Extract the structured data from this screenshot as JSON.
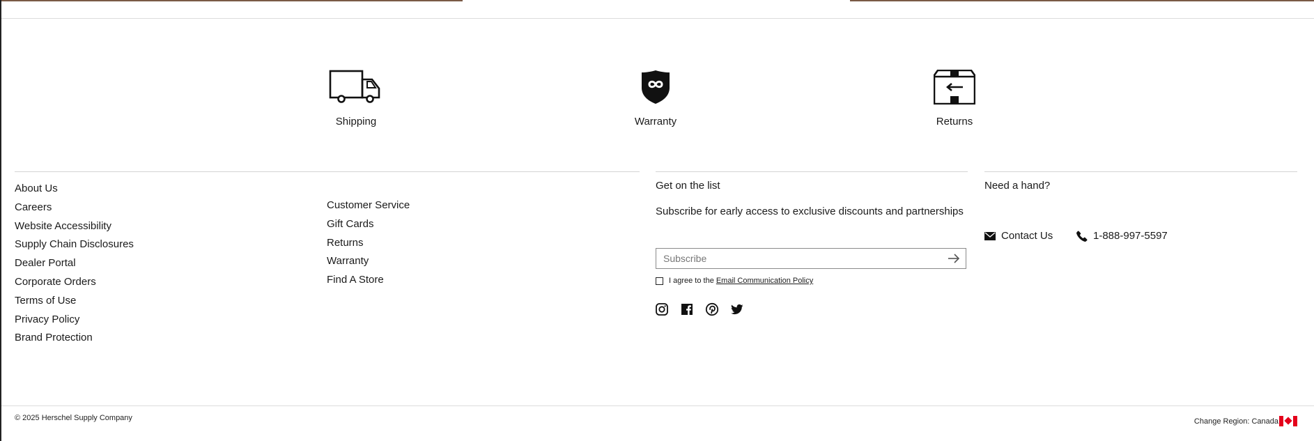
{
  "features": [
    {
      "label": "Shipping",
      "icon": "truck-icon"
    },
    {
      "label": "Warranty",
      "icon": "infinity-shield-icon"
    },
    {
      "label": "Returns",
      "icon": "return-box-icon"
    }
  ],
  "footer": {
    "company_links": [
      "About Us",
      "Careers",
      "Website Accessibility",
      "Supply Chain Disclosures",
      "Dealer Portal",
      "Corporate Orders",
      "Terms of Use",
      "Privacy Policy",
      "Brand Protection"
    ],
    "support_links": [
      "Customer Service",
      "Gift Cards",
      "Returns",
      "Warranty",
      "Find A Store"
    ]
  },
  "newsletter": {
    "title": "Get on the list",
    "description": "Subscribe for early access to exclusive discounts and partnerships",
    "input_placeholder": "Subscribe",
    "input_value": "",
    "agree_text": "I agree to the",
    "policy_link": "Email Communication Policy"
  },
  "social": [
    {
      "name": "instagram-icon"
    },
    {
      "name": "facebook-icon"
    },
    {
      "name": "pinterest-icon"
    },
    {
      "name": "twitter-icon"
    }
  ],
  "help": {
    "title": "Need a hand?",
    "contact_label": "Contact Us",
    "phone": "1-888-997-5597"
  },
  "bottom": {
    "copyright": "© 2025 Herschel Supply Company",
    "region_label": "Change Region: Canada"
  },
  "colors": {
    "accent": "#1a1a1a",
    "flag_red": "#e4001b",
    "banner_brown": "#7a5a46"
  }
}
